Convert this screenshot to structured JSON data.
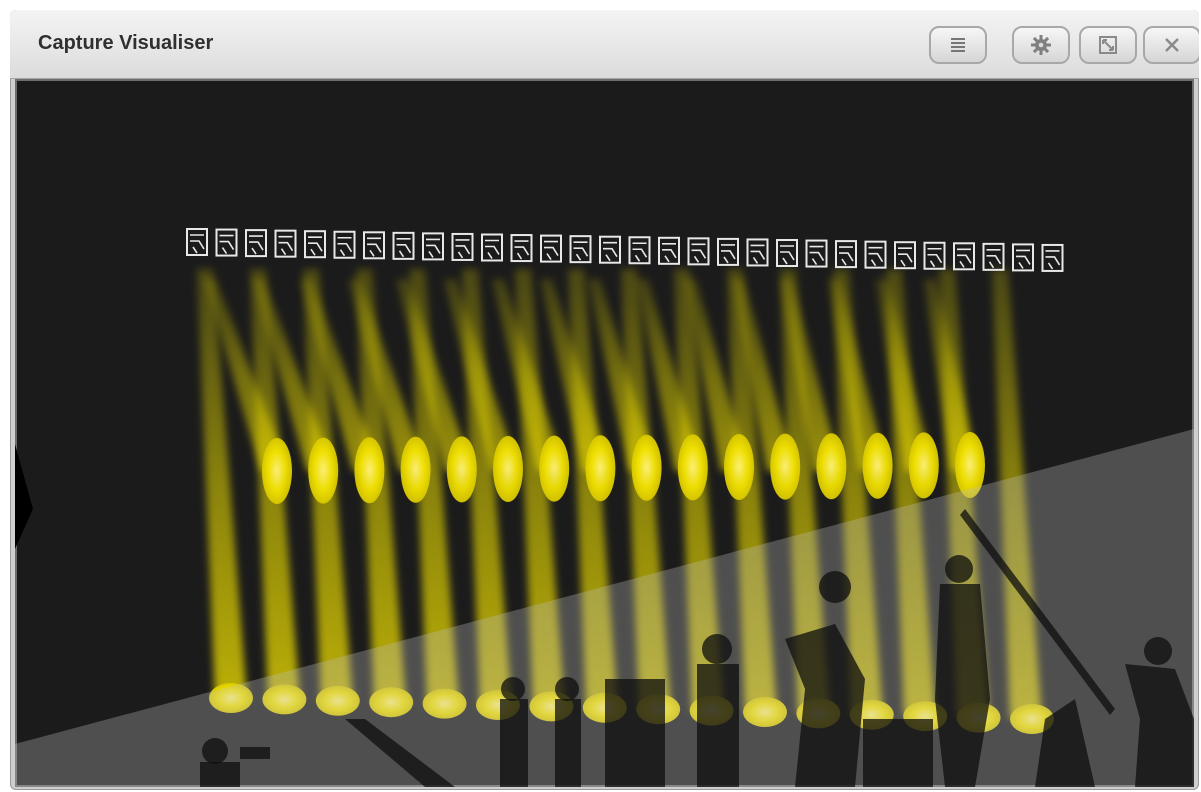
{
  "window": {
    "title": "Capture Visualiser",
    "buttons": {
      "menu": "menu-icon",
      "settings": "gear-icon",
      "resize": "resize-icon",
      "close": "close-icon"
    }
  },
  "colors": {
    "background": "#1b1b1b",
    "beam": "#f2e200",
    "floor": "#5a5a5a",
    "titlebar": "#e6e6e6"
  },
  "scene": {
    "fixture_count": 30,
    "beam_spot_count": 16,
    "floor_spot_count": 16
  }
}
